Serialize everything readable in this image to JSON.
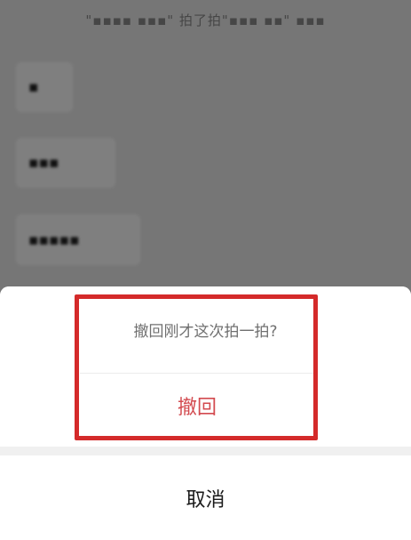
{
  "chat": {
    "system_message": "\"▪▪▪▪ ▪▪▪\" 拍了拍\"▪▪▪ ▪▪\" ▪▪▪",
    "bubbles": [
      "▪",
      "▪▪▪",
      "▪▪▪▪▪"
    ]
  },
  "action_sheet": {
    "prompt": "撤回刚才这次拍一拍?",
    "revoke_label": "撤回",
    "cancel_label": "取消"
  },
  "colors": {
    "revoke": "#d34a4f",
    "highlight": "#d42a2a"
  }
}
